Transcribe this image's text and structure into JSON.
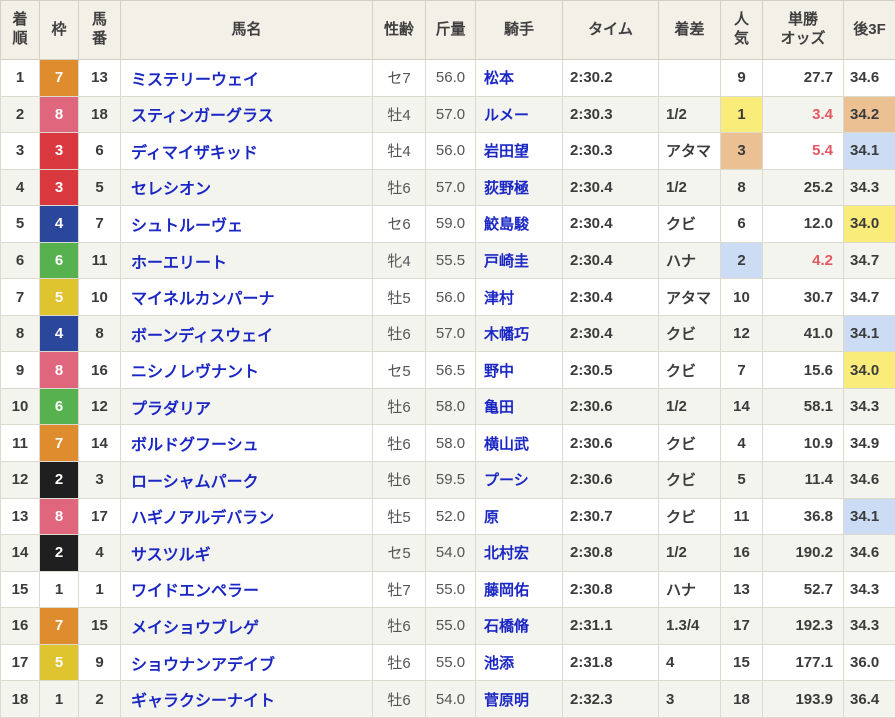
{
  "colors": {
    "link_blue": "#1b27c4",
    "odds_red": "#e25863",
    "frame": {
      "1": "#ffffff",
      "2": "#1f1f1f",
      "3": "#d9383e",
      "4": "#2a479c",
      "5": "#dfc32f",
      "6": "#57b14e",
      "7": "#de8c2d",
      "8": "#e0667e"
    },
    "highlight": {
      "yellow": "#f9ec7a",
      "blue": "#cbdcf4",
      "tan": "#ebc193"
    }
  },
  "table": {
    "columns": [
      {
        "key": "pos",
        "label": "着\n順"
      },
      {
        "key": "frame",
        "label": "枠"
      },
      {
        "key": "num",
        "label": "馬\n番"
      },
      {
        "key": "name",
        "label": "馬名"
      },
      {
        "key": "sex_age",
        "label": "性齢"
      },
      {
        "key": "weight",
        "label": "斤量"
      },
      {
        "key": "jockey",
        "label": "騎手"
      },
      {
        "key": "time",
        "label": "タイム"
      },
      {
        "key": "margin",
        "label": "着差"
      },
      {
        "key": "pop",
        "label": "人\n気"
      },
      {
        "key": "odds",
        "label": "単勝\nオッズ"
      },
      {
        "key": "last3f",
        "label": "後3F"
      }
    ],
    "rows": [
      {
        "pos": "1",
        "frame": "7",
        "num": "13",
        "name": "ミステリーウェイ",
        "sex_age": "セ7",
        "weight": "56.0",
        "jockey": "松本",
        "time": "2:30.2",
        "margin": "",
        "pop": "9",
        "odds": "27.7",
        "last3f": "34.6",
        "pop_hl": null,
        "odds_hot": false,
        "last3f_hl": null
      },
      {
        "pos": "2",
        "frame": "8",
        "num": "18",
        "name": "スティンガーグラス",
        "sex_age": "牡4",
        "weight": "57.0",
        "jockey": "ルメー",
        "time": "2:30.3",
        "margin": "1/2",
        "pop": "1",
        "odds": "3.4",
        "last3f": "34.2",
        "pop_hl": "yellow",
        "odds_hot": true,
        "last3f_hl": "tan"
      },
      {
        "pos": "3",
        "frame": "3",
        "num": "6",
        "name": "ディマイザキッド",
        "sex_age": "牡4",
        "weight": "56.0",
        "jockey": "岩田望",
        "time": "2:30.3",
        "margin": "アタマ",
        "pop": "3",
        "odds": "5.4",
        "last3f": "34.1",
        "pop_hl": "tan",
        "odds_hot": true,
        "last3f_hl": "blue"
      },
      {
        "pos": "4",
        "frame": "3",
        "num": "5",
        "name": "セレシオン",
        "sex_age": "牡6",
        "weight": "57.0",
        "jockey": "荻野極",
        "time": "2:30.4",
        "margin": "1/2",
        "pop": "8",
        "odds": "25.2",
        "last3f": "34.3",
        "pop_hl": null,
        "odds_hot": false,
        "last3f_hl": null
      },
      {
        "pos": "5",
        "frame": "4",
        "num": "7",
        "name": "シュトルーヴェ",
        "sex_age": "セ6",
        "weight": "59.0",
        "jockey": "鮫島駿",
        "time": "2:30.4",
        "margin": "クビ",
        "pop": "6",
        "odds": "12.0",
        "last3f": "34.0",
        "pop_hl": null,
        "odds_hot": false,
        "last3f_hl": "yellow"
      },
      {
        "pos": "6",
        "frame": "6",
        "num": "11",
        "name": "ホーエリート",
        "sex_age": "牝4",
        "weight": "55.5",
        "jockey": "戸崎圭",
        "time": "2:30.4",
        "margin": "ハナ",
        "pop": "2",
        "odds": "4.2",
        "last3f": "34.7",
        "pop_hl": "blue",
        "odds_hot": true,
        "last3f_hl": null
      },
      {
        "pos": "7",
        "frame": "5",
        "num": "10",
        "name": "マイネルカンパーナ",
        "sex_age": "牡5",
        "weight": "56.0",
        "jockey": "津村",
        "time": "2:30.4",
        "margin": "アタマ",
        "pop": "10",
        "odds": "30.7",
        "last3f": "34.7",
        "pop_hl": null,
        "odds_hot": false,
        "last3f_hl": null
      },
      {
        "pos": "8",
        "frame": "4",
        "num": "8",
        "name": "ボーンディスウェイ",
        "sex_age": "牡6",
        "weight": "57.0",
        "jockey": "木幡巧",
        "time": "2:30.4",
        "margin": "クビ",
        "pop": "12",
        "odds": "41.0",
        "last3f": "34.1",
        "pop_hl": null,
        "odds_hot": false,
        "last3f_hl": "blue"
      },
      {
        "pos": "9",
        "frame": "8",
        "num": "16",
        "name": "ニシノレヴナント",
        "sex_age": "セ5",
        "weight": "56.5",
        "jockey": "野中",
        "time": "2:30.5",
        "margin": "クビ",
        "pop": "7",
        "odds": "15.6",
        "last3f": "34.0",
        "pop_hl": null,
        "odds_hot": false,
        "last3f_hl": "yellow"
      },
      {
        "pos": "10",
        "frame": "6",
        "num": "12",
        "name": "プラダリア",
        "sex_age": "牡6",
        "weight": "58.0",
        "jockey": "亀田",
        "time": "2:30.6",
        "margin": "1/2",
        "pop": "14",
        "odds": "58.1",
        "last3f": "34.3",
        "pop_hl": null,
        "odds_hot": false,
        "last3f_hl": null
      },
      {
        "pos": "11",
        "frame": "7",
        "num": "14",
        "name": "ボルドグフーシュ",
        "sex_age": "牡6",
        "weight": "58.0",
        "jockey": "横山武",
        "time": "2:30.6",
        "margin": "クビ",
        "pop": "4",
        "odds": "10.9",
        "last3f": "34.9",
        "pop_hl": null,
        "odds_hot": false,
        "last3f_hl": null
      },
      {
        "pos": "12",
        "frame": "2",
        "num": "3",
        "name": "ローシャムパーク",
        "sex_age": "牡6",
        "weight": "59.5",
        "jockey": "プーシ",
        "time": "2:30.6",
        "margin": "クビ",
        "pop": "5",
        "odds": "11.4",
        "last3f": "34.6",
        "pop_hl": null,
        "odds_hot": false,
        "last3f_hl": null
      },
      {
        "pos": "13",
        "frame": "8",
        "num": "17",
        "name": "ハギノアルデバラン",
        "sex_age": "牡5",
        "weight": "52.0",
        "jockey": "原",
        "time": "2:30.7",
        "margin": "クビ",
        "pop": "11",
        "odds": "36.8",
        "last3f": "34.1",
        "pop_hl": null,
        "odds_hot": false,
        "last3f_hl": "blue"
      },
      {
        "pos": "14",
        "frame": "2",
        "num": "4",
        "name": "サスツルギ",
        "sex_age": "セ5",
        "weight": "54.0",
        "jockey": "北村宏",
        "time": "2:30.8",
        "margin": "1/2",
        "pop": "16",
        "odds": "190.2",
        "last3f": "34.6",
        "pop_hl": null,
        "odds_hot": false,
        "last3f_hl": null
      },
      {
        "pos": "15",
        "frame": "1",
        "num": "1",
        "name": "ワイドエンペラー",
        "sex_age": "牡7",
        "weight": "55.0",
        "jockey": "藤岡佑",
        "time": "2:30.8",
        "margin": "ハナ",
        "pop": "13",
        "odds": "52.7",
        "last3f": "34.3",
        "pop_hl": null,
        "odds_hot": false,
        "last3f_hl": null
      },
      {
        "pos": "16",
        "frame": "7",
        "num": "15",
        "name": "メイショウブレゲ",
        "sex_age": "牡6",
        "weight": "55.0",
        "jockey": "石橋脩",
        "time": "2:31.1",
        "margin": "1.3/4",
        "pop": "17",
        "odds": "192.3",
        "last3f": "34.3",
        "pop_hl": null,
        "odds_hot": false,
        "last3f_hl": null
      },
      {
        "pos": "17",
        "frame": "5",
        "num": "9",
        "name": "ショウナンアデイブ",
        "sex_age": "牡6",
        "weight": "55.0",
        "jockey": "池添",
        "time": "2:31.8",
        "margin": "4",
        "pop": "15",
        "odds": "177.1",
        "last3f": "36.0",
        "pop_hl": null,
        "odds_hot": false,
        "last3f_hl": null
      },
      {
        "pos": "18",
        "frame": "1",
        "num": "2",
        "name": "ギャラクシーナイト",
        "sex_age": "牡6",
        "weight": "54.0",
        "jockey": "菅原明",
        "time": "2:32.3",
        "margin": "3",
        "pop": "18",
        "odds": "193.9",
        "last3f": "36.4",
        "pop_hl": null,
        "odds_hot": false,
        "last3f_hl": null
      }
    ]
  }
}
